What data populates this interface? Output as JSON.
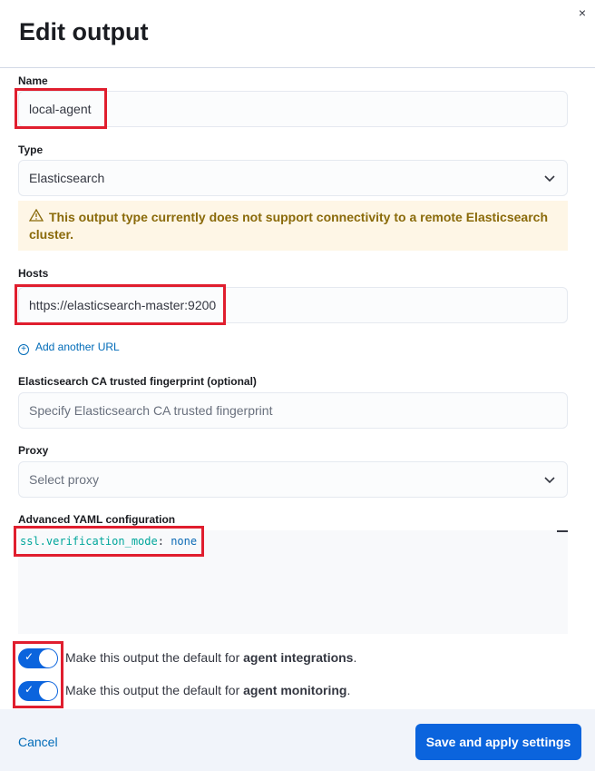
{
  "header": {
    "title": "Edit output",
    "close_glyph": "×"
  },
  "form": {
    "name": {
      "label": "Name",
      "value": "local-agent"
    },
    "type": {
      "label": "Type",
      "value": "Elasticsearch"
    },
    "callout": {
      "text": "This output type currently does not support connectivity to a remote Elasticsearch cluster."
    },
    "hosts": {
      "label": "Hosts",
      "value": "https://elasticsearch-master:9200",
      "add_link": "Add another URL"
    },
    "fingerprint": {
      "label": "Elasticsearch CA trusted fingerprint (optional)",
      "placeholder": "Specify Elasticsearch CA trusted fingerprint"
    },
    "proxy": {
      "label": "Proxy",
      "placeholder": "Select proxy"
    },
    "yaml": {
      "label": "Advanced YAML configuration",
      "key": "ssl.verification_mode",
      "sep": ":",
      "value": "none"
    },
    "toggles": [
      {
        "prefix": "Make this output the default for ",
        "bold": "agent integrations",
        "suffix": ".",
        "checked": true
      },
      {
        "prefix": "Make this output the default for ",
        "bold": "agent monitoring",
        "suffix": ".",
        "checked": true
      }
    ]
  },
  "footer": {
    "cancel_label": "Cancel",
    "save_label": "Save and apply settings"
  },
  "colors": {
    "primary": "#0b64dd",
    "link": "#006bb8",
    "warning_bg": "#fef6e6",
    "highlight": "#e01e2e"
  }
}
